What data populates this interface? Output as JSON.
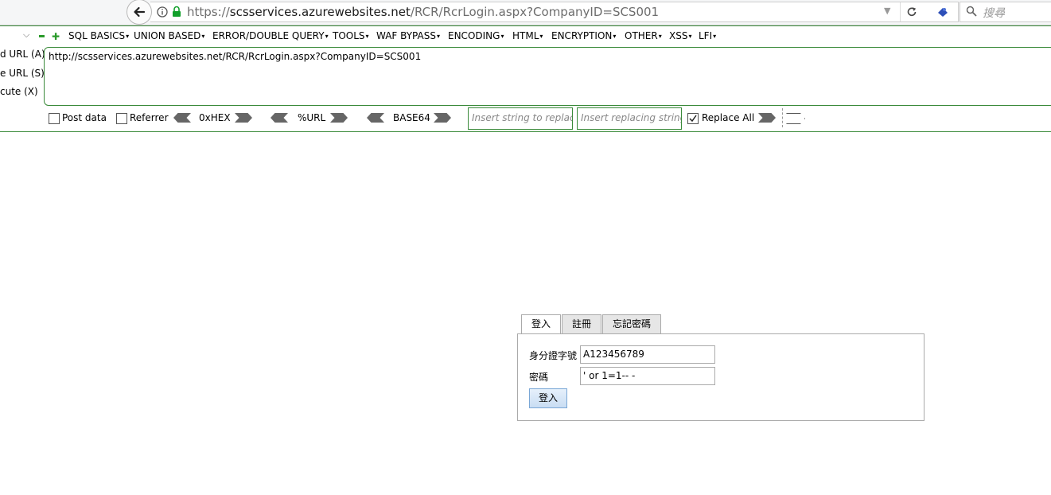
{
  "browser": {
    "url_scheme": "https://",
    "url_host": "scsservices.azurewebsites.net",
    "url_path": "/RCR/RcrLogin.aspx?CompanyID=SCS001",
    "search_placeholder": "搜尋",
    "icons": [
      "back-arrow-icon",
      "info-icon",
      "lock-icon",
      "dropdown-icon",
      "reload-icon",
      "extension-icon",
      "search-icon"
    ]
  },
  "hackbar": {
    "menu": [
      "SQL BASICS",
      "UNION BASED",
      "ERROR/DOUBLE QUERY",
      "TOOLS",
      "WAF BYPASS",
      "ENCODING",
      "HTML",
      "ENCRYPTION",
      "OTHER",
      "XSS",
      "LFI"
    ],
    "side_buttons": [
      "d URL (A)",
      "e URL (S)",
      "cute (X)"
    ],
    "url_value": "http://scsservices.azurewebsites.net/RCR/RcrLogin.aspx?CompanyID=SCS001",
    "post_data_label": "Post data",
    "referrer_label": "Referrer",
    "hex_label": "0xHEX",
    "url_enc_label": "%URL",
    "base64_label": "BASE64",
    "replace_placeholder": "Insert string to replace",
    "replacing_placeholder": "Insert replacing string",
    "replace_all_label": "Replace All",
    "replace_all_checked": true,
    "accent_color": "#3a8a3a"
  },
  "login": {
    "tabs": [
      "登入",
      "註冊",
      "忘記密碼"
    ],
    "id_label": "身分證字號",
    "id_value": "A123456789",
    "password_label": "密碼",
    "password_value": "' or 1=1-- -",
    "submit_label": "登入"
  }
}
